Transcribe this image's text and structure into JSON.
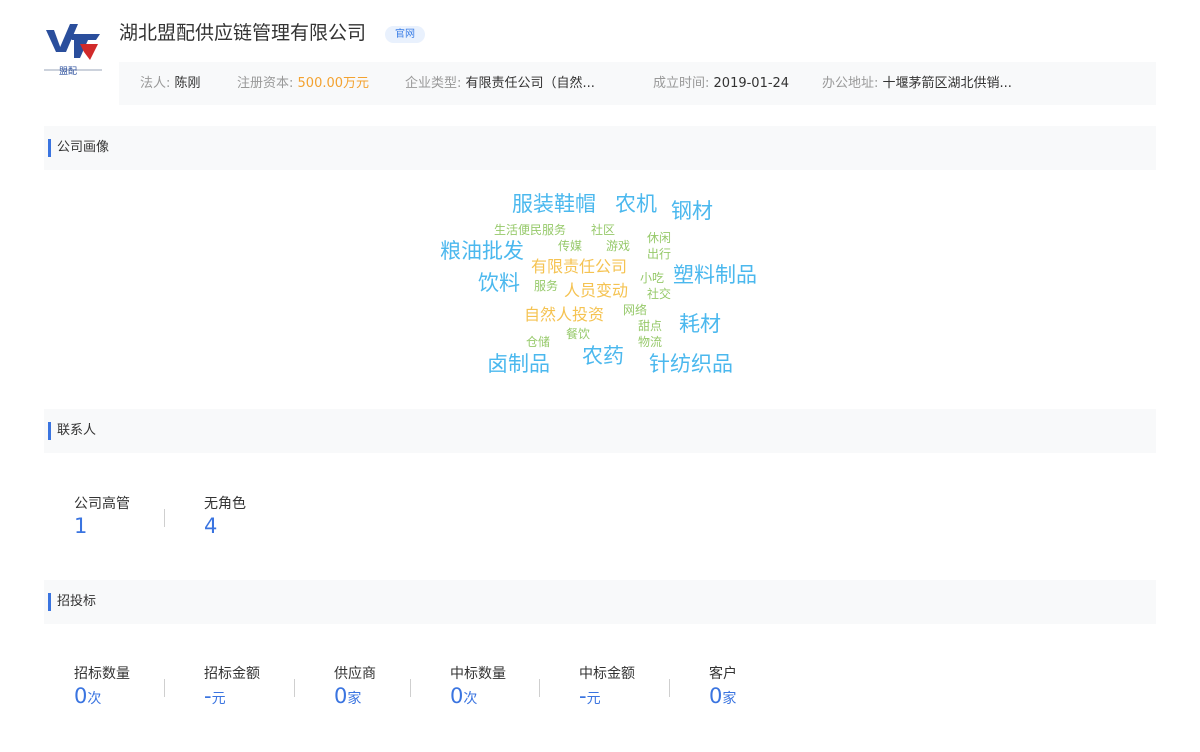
{
  "company": {
    "name": "湖北盟配供应链管理有限公司",
    "badge": "官网",
    "logo_text": "盟配"
  },
  "info": {
    "legal_rep_label": "法人:",
    "legal_rep": "陈刚",
    "capital_label": "注册资本:",
    "capital": "500.00万元",
    "type_label": "企业类型:",
    "type": "有限责任公司（自然...",
    "founded_label": "成立时间:",
    "founded": "2019-01-24",
    "address_label": "办公地址:",
    "address": "十堰茅箭区湖北供销..."
  },
  "sections": {
    "portrait": "公司画像",
    "contacts": "联系人",
    "bidding": "招投标"
  },
  "word_cloud": [
    {
      "text": "服装鞋帽",
      "color": "blue"
    },
    {
      "text": "农机",
      "color": "blue"
    },
    {
      "text": "钢材",
      "color": "blue"
    },
    {
      "text": "生活便民服务",
      "color": "green"
    },
    {
      "text": "社区",
      "color": "green"
    },
    {
      "text": "休闲",
      "color": "green"
    },
    {
      "text": "粮油批发",
      "color": "blue"
    },
    {
      "text": "传媒",
      "color": "green"
    },
    {
      "text": "游戏",
      "color": "green"
    },
    {
      "text": "出行",
      "color": "green"
    },
    {
      "text": "有限责任公司",
      "color": "yellow"
    },
    {
      "text": "饮料",
      "color": "blue"
    },
    {
      "text": "小吃",
      "color": "green"
    },
    {
      "text": "塑料制品",
      "color": "blue"
    },
    {
      "text": "服务",
      "color": "green"
    },
    {
      "text": "人员变动",
      "color": "yellow"
    },
    {
      "text": "社交",
      "color": "green"
    },
    {
      "text": "网络",
      "color": "green"
    },
    {
      "text": "自然人投资",
      "color": "yellow"
    },
    {
      "text": "甜点",
      "color": "green"
    },
    {
      "text": "耗材",
      "color": "blue"
    },
    {
      "text": "餐饮",
      "color": "green"
    },
    {
      "text": "仓储",
      "color": "green"
    },
    {
      "text": "物流",
      "color": "green"
    },
    {
      "text": "农药",
      "color": "blue"
    },
    {
      "text": "卤制品",
      "color": "blue"
    },
    {
      "text": "针纺织品",
      "color": "blue"
    }
  ],
  "colors": {
    "blue": "#4bb8ee",
    "green": "#96c96a",
    "yellow": "#f5c352",
    "accent": "#3a74e0",
    "capital": "#f3a230"
  },
  "contacts": [
    {
      "label": "公司高管",
      "value": "1"
    },
    {
      "label": "无角色",
      "value": "4"
    }
  ],
  "bidding": [
    {
      "label": "招标数量",
      "value": "0",
      "unit": "次"
    },
    {
      "label": "招标金额",
      "value": "-",
      "unit": "元"
    },
    {
      "label": "供应商",
      "value": "0",
      "unit": "家"
    },
    {
      "label": "中标数量",
      "value": "0",
      "unit": "次"
    },
    {
      "label": "中标金额",
      "value": "-",
      "unit": "元"
    },
    {
      "label": "客户",
      "value": "0",
      "unit": "家"
    }
  ]
}
